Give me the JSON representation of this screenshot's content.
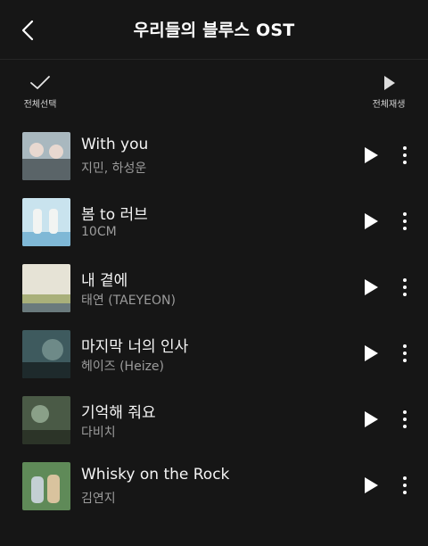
{
  "header": {
    "title": "우리들의 블루스 OST",
    "back_icon": "chevron-left-icon"
  },
  "controls": {
    "select_all_label": "전체선택",
    "select_all_icon": "check-icon",
    "play_all_label": "전체재생",
    "play_all_icon": "play-icon"
  },
  "songs": [
    {
      "title": "With you",
      "artist": "지민, 하성운",
      "art_colors": [
        "#a9b8bf",
        "#e8d8d0",
        "#5a6468"
      ]
    },
    {
      "title": "봄 to 러브",
      "artist": "10CM",
      "art_colors": [
        "#c9e3ee",
        "#7fb8d6",
        "#f2f4f2"
      ]
    },
    {
      "title": "내 곁에",
      "artist": "태연 (TAEYEON)",
      "art_colors": [
        "#e6e3d6",
        "#a9b07a",
        "#6a7a7d"
      ]
    },
    {
      "title": "마지막 너의 인사",
      "artist": "헤이즈 (Heize)",
      "art_colors": [
        "#3e5a5e",
        "#6e8a88",
        "#1e2a2c"
      ]
    },
    {
      "title": "기억해 줘요",
      "artist": "다비치",
      "art_colors": [
        "#4a5a46",
        "#8aa088",
        "#2c3428"
      ]
    },
    {
      "title": "Whisky on the Rock",
      "artist": "김연지",
      "art_colors": [
        "#5f8a58",
        "#c3cfd3",
        "#d9c39e"
      ]
    }
  ],
  "colors": {
    "background": "#161616",
    "text": "#ffffff",
    "subtext": "#9b9b9b"
  }
}
